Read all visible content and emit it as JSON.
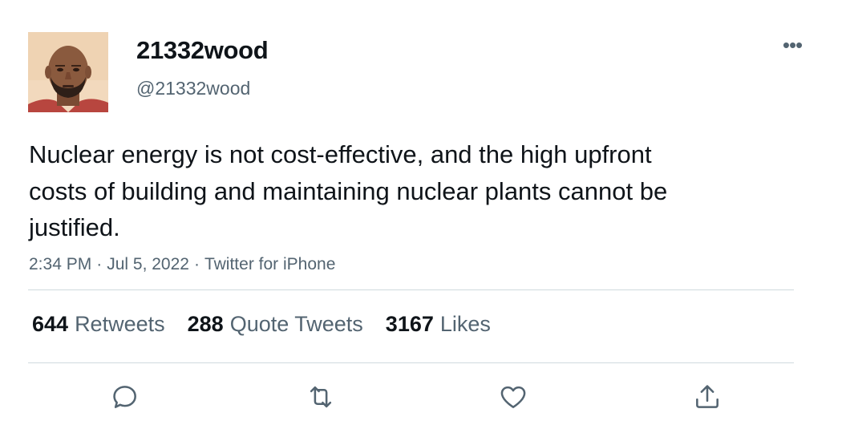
{
  "tweet": {
    "display_name": "21332wood",
    "handle": "@21332wood",
    "text": "Nuclear energy is not cost-effective, and the high upfront costs of building and maintaining nuclear plants cannot be justified.",
    "time": "2:34 PM",
    "date": "Jul 5, 2022",
    "source": "Twitter for iPhone",
    "separator": "·",
    "more_label": "•••"
  },
  "stats": {
    "retweets_count": "644",
    "retweets_label": "Retweets",
    "quotes_count": "288",
    "quotes_label": "Quote Tweets",
    "likes_count": "3167",
    "likes_label": "Likes"
  },
  "actions": {
    "reply_icon": "reply-icon",
    "retweet_icon": "retweet-icon",
    "like_icon": "heart-icon",
    "share_icon": "share-icon"
  },
  "colors": {
    "text_primary": "#0f1419",
    "text_secondary": "#536471",
    "divider": "#cfd9de"
  }
}
